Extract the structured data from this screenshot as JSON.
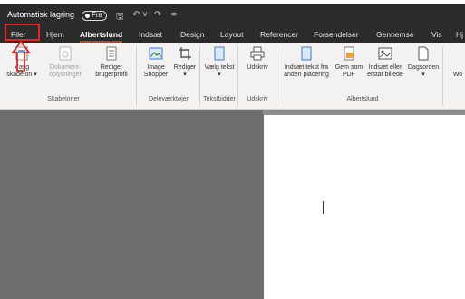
{
  "titlebar": {
    "autosave_label": "Automatisk lagring",
    "autosave_state": "Fra",
    "qa_save": "🖫",
    "qa_undo": "↶ ˅",
    "qa_redo": "↷",
    "qa_more": "="
  },
  "tabs": [
    "Filer",
    "Hjem",
    "Albertslund",
    "Indsæt",
    "Design",
    "Layout",
    "Referencer",
    "Forsendelser",
    "Gennemse",
    "Vis",
    "Hj"
  ],
  "active_tab": "Albertslund",
  "ribbon": {
    "buttons": [
      {
        "label": "Vælg skabelon ▾",
        "icon": "template-icon"
      },
      {
        "label": "Dokument-oplysninger",
        "icon": "document-info-icon",
        "disabled": true
      },
      {
        "label": "Rediger brugerprofil",
        "icon": "user-profile-icon"
      },
      {
        "label": "Image Shopper",
        "icon": "image-icon"
      },
      {
        "label": "Rediger ▾",
        "icon": "crop-icon"
      },
      {
        "label": "Vælg tekst ▾",
        "icon": "text-block-icon"
      },
      {
        "label": "Udskriv",
        "icon": "print-icon"
      },
      {
        "label": "Indsæt tekst fra anden placering",
        "icon": "insert-text-icon"
      },
      {
        "label": "Gem som PDF",
        "icon": "pdf-icon"
      },
      {
        "label": "Indsæt eller erstat billede",
        "icon": "replace-image-icon"
      },
      {
        "label": "Dagsorden ▾",
        "icon": "agenda-icon"
      },
      {
        "label": "Wo",
        "icon": ""
      }
    ],
    "groups": [
      "Skabeloner",
      "Deleværktøjer",
      "Tekstbidder",
      "Udskriv",
      "Albertslund"
    ]
  },
  "colors": {
    "title_bg": "#2b2b2b",
    "ribbon_bg": "#f3f2f1",
    "workspace_bg": "#6e6e6e",
    "highlight": "#e0282b",
    "accent": "#b7472a"
  }
}
